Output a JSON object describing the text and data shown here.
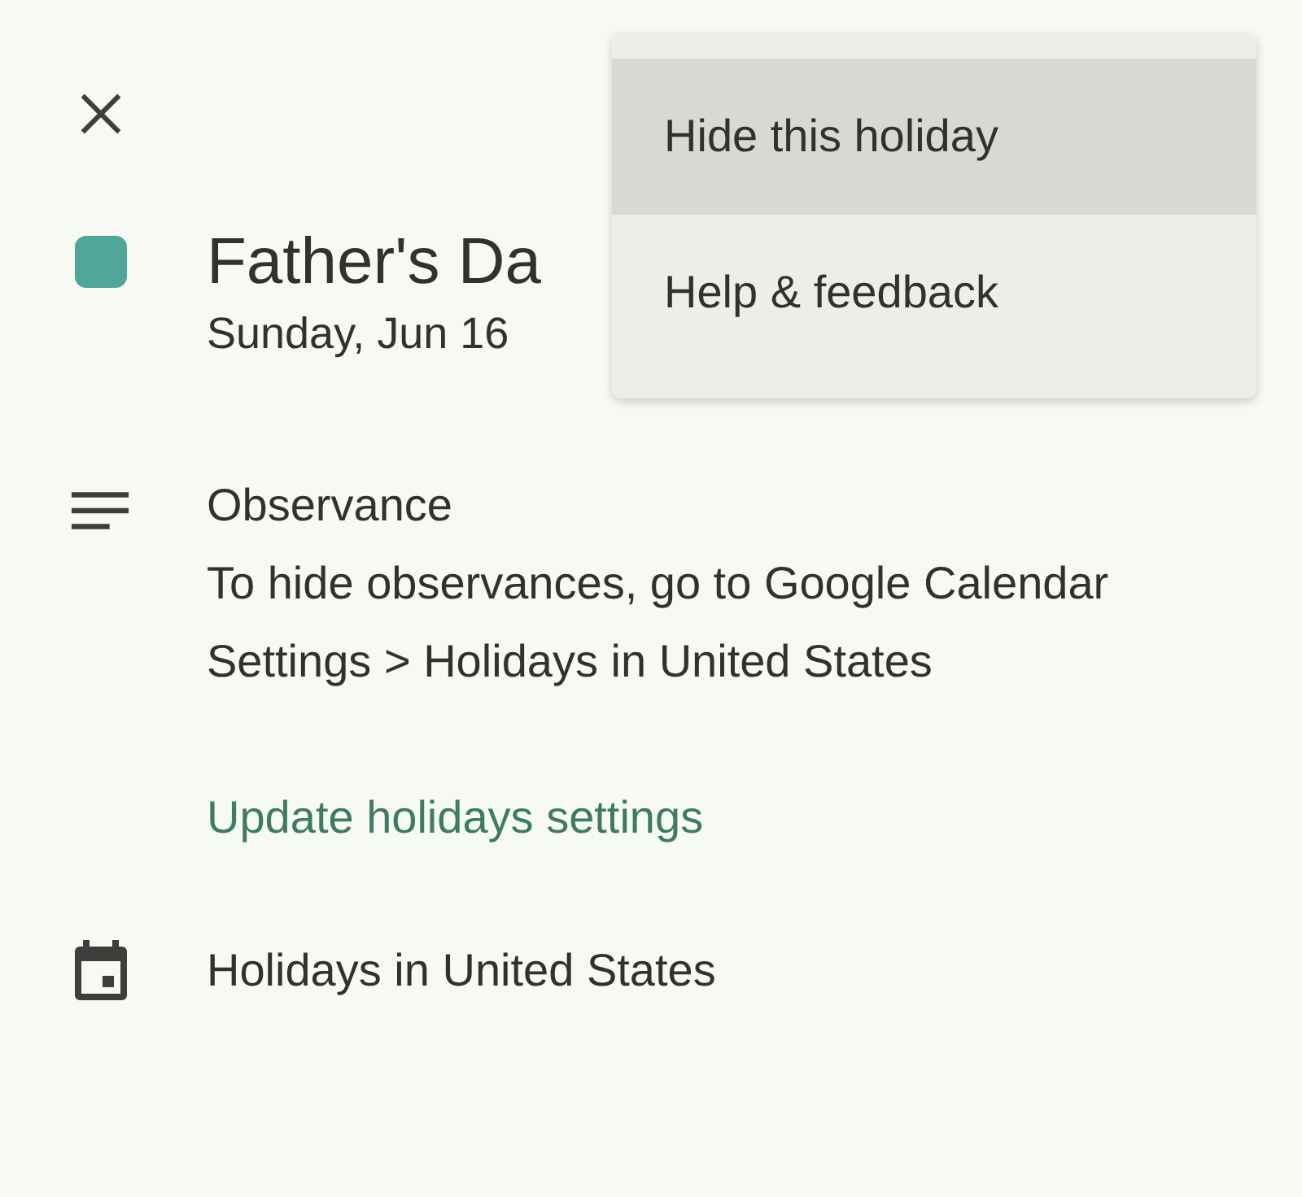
{
  "event": {
    "title": "Father's Da",
    "date": "Sunday, Jun 16",
    "color": "#4fa69a"
  },
  "description": {
    "heading": "Observance",
    "text": "To hide observances, go to Google Calendar Settings > Holidays in United States",
    "link": "Update holidays settings"
  },
  "calendar": {
    "name": "Holidays in United States"
  },
  "menu": {
    "items": [
      {
        "label": "Hide this holiday",
        "selected": true
      },
      {
        "label": "Help & feedback",
        "selected": false
      }
    ]
  }
}
